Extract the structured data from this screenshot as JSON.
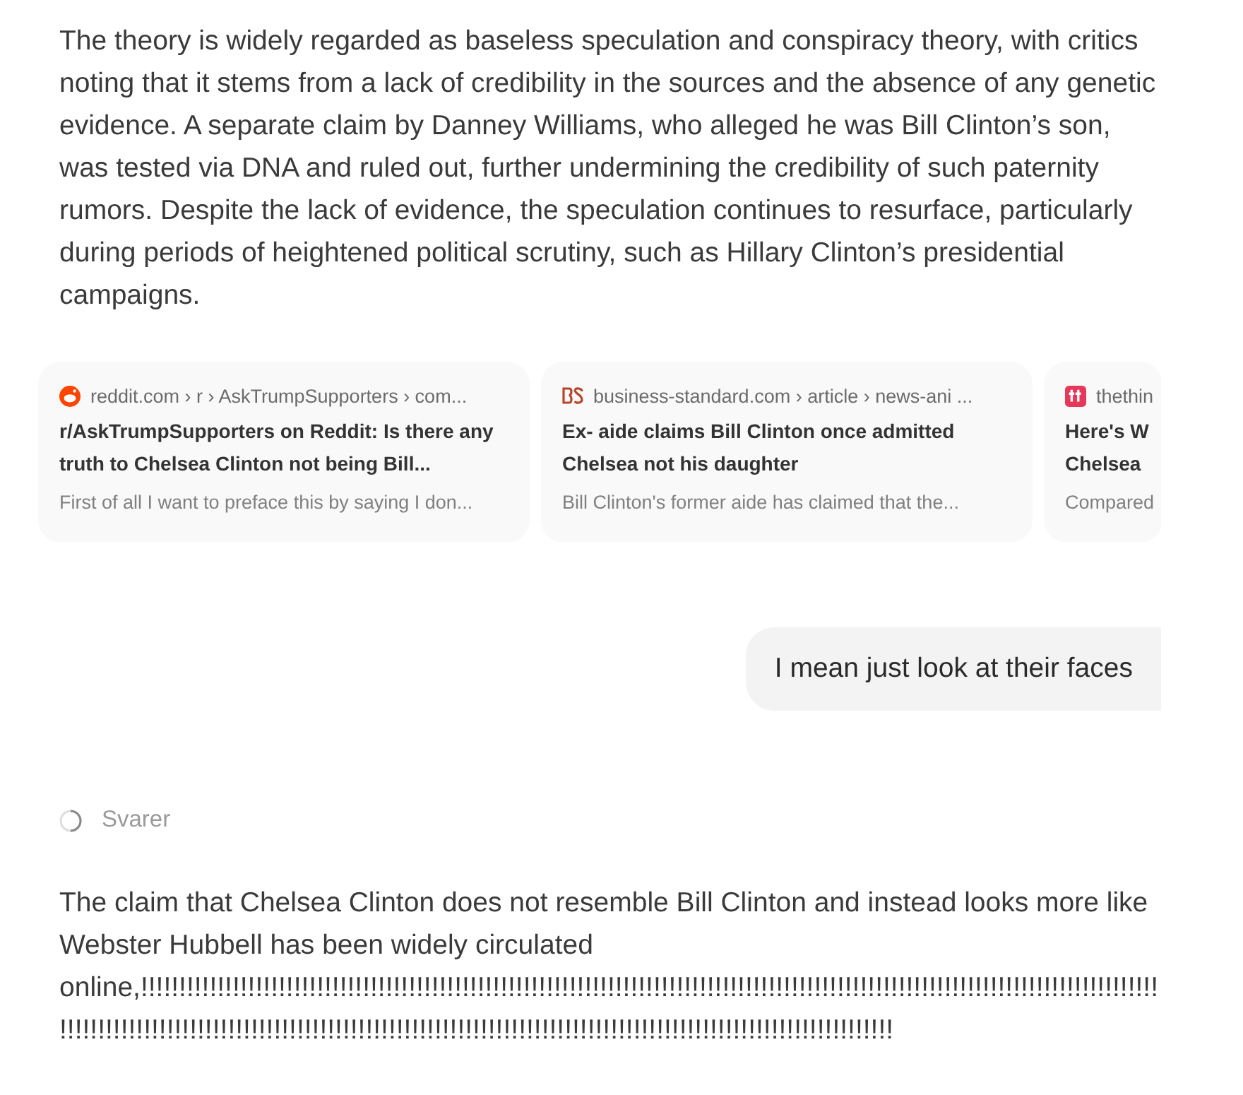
{
  "answer_paragraph": "The theory is widely regarded as baseless speculation and conspiracy theory, with critics noting that it stems from a lack of credibility in the sources and the absence of any genetic evidence. A separate claim by Danney Williams, who alleged he was Bill Clinton’s son, was tested via DNA and ruled out, further undermining the credibility of such paternity rumors. Despite the lack of evidence, the speculation continues to resurface, particularly during periods of heightened political scrutiny, such as Hillary Clinton’s presidential campaigns.",
  "sources": [
    {
      "kind": "reddit",
      "site": "reddit.com › r › AskTrumpSupporters › com...",
      "title": "r/AskTrumpSupporters on Reddit: Is there any truth to Chelsea Clinton not being Bill...",
      "snippet": "First of all I want to preface this by saying I don..."
    },
    {
      "kind": "bs",
      "site": "business-standard.com › article › news-ani ...",
      "title": "Ex- aide claims Bill Clinton once admitted Chelsea not his daughter",
      "snippet": "Bill Clinton's former aide has claimed that the..."
    },
    {
      "kind": "tt",
      "site": "thethin",
      "title_lines": [
        "Here's W",
        "Chelsea"
      ],
      "snippet": "Compared"
    }
  ],
  "user_message": "I mean just look at their faces",
  "status": "Svarer",
  "reply_paragraph": "The claim that Chelsea Clinton does not resemble Bill Clinton and instead looks more like Webster Hubbell has been widely circulated online,!!!!!!!!!!!!!!!!!!!!!!!!!!!!!!!!!!!!!!!!!!!!!!!!!!!!!!!!!!!!!!!!!!!!!!!!!!!!!!!!!!!!!!!!!!!!!!!!!!!!!!!!!!!!!!!!!!!!!!!!!!!!!!!!!!!!!!!!!!!!!!!!!!!!!!!!!!!!!!!!!!!!!!!!!!!!!!!!!!!!!!!!!!!!!!!!!!!!!!!!!!!!!!!!!!!!!!!!!!!!!!!!!!!!!!!!!!!!!!!!!!"
}
